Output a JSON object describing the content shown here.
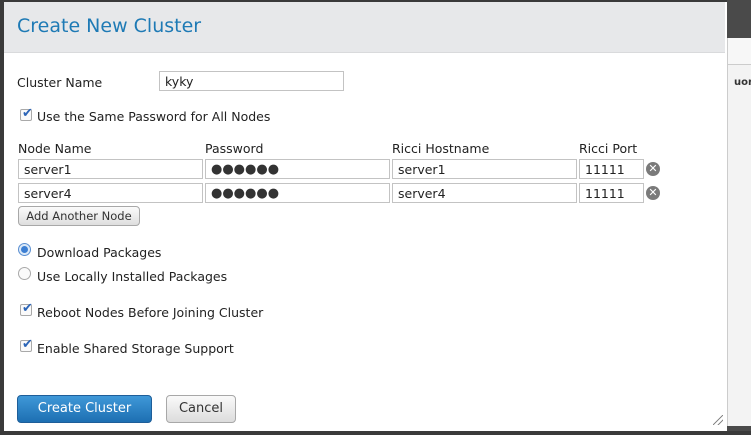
{
  "dialog": {
    "title": "Create New Cluster"
  },
  "cluster_name": {
    "label": "Cluster Name",
    "value": "kyky"
  },
  "same_password": {
    "label": "Use the Same Password for All Nodes",
    "checked": true
  },
  "nodes_table": {
    "headers": {
      "node_name": "Node Name",
      "password": "Password",
      "ricci_hostname": "Ricci Hostname",
      "ricci_port": "Ricci Port"
    },
    "rows": [
      {
        "node_name": "server1",
        "password": "●●●●●●",
        "ricci_hostname": "server1",
        "ricci_port": "11111"
      },
      {
        "node_name": "server4",
        "password": "●●●●●●",
        "ricci_hostname": "server4",
        "ricci_port": "11111"
      }
    ],
    "add_button": "Add Another Node"
  },
  "packages": {
    "download": {
      "label": "Download Packages",
      "selected": true
    },
    "local": {
      "label": "Use Locally Installed Packages",
      "selected": false
    }
  },
  "reboot_nodes": {
    "label": "Reboot Nodes Before Joining Cluster",
    "checked": true
  },
  "shared_storage": {
    "label": "Enable Shared Storage Support",
    "checked": true
  },
  "actions": {
    "create": "Create Cluster",
    "cancel": "Cancel"
  },
  "background": {
    "tab_fragment": "uoru"
  },
  "icons": {
    "remove": "remove-circle-icon",
    "check": "checkmark-icon"
  },
  "colors": {
    "title": "#1e7ab5",
    "primary_button": "#2a80c4",
    "header_bg": "#e7e8ea"
  }
}
